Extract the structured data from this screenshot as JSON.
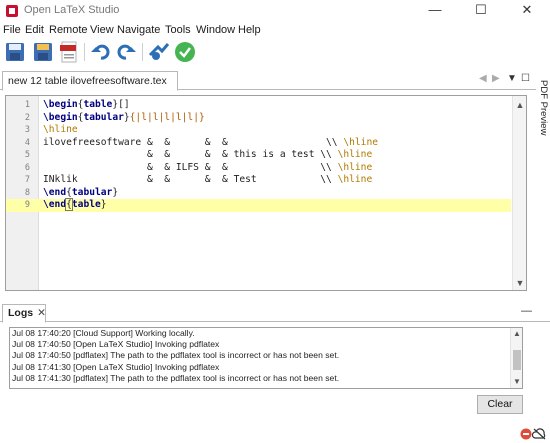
{
  "window": {
    "title": "Open LaTeX Studio",
    "minimize": "—",
    "maximize": "☐",
    "close": "✕"
  },
  "menu": [
    "File",
    "Edit",
    "Remote",
    "View",
    "Navigate",
    "Tools",
    "Window",
    "Help"
  ],
  "toolbar": {
    "icons": [
      "save-icon",
      "save-all-icon",
      "pdf-export-icon",
      "undo-icon",
      "redo-icon",
      "dropbox-icon",
      "compile-check-icon"
    ],
    "colors": {
      "save": "#4472c4",
      "undo": "#2d6fb7",
      "compile": "#46b450"
    }
  },
  "editor": {
    "tab_label": "new 12 table ilovefreesoftware.tex",
    "tab_controls": [
      "◀",
      "▶",
      "▼",
      "☐"
    ],
    "lines": [
      {
        "n": "1",
        "parts": [
          [
            "kw",
            "\\begin"
          ],
          [
            "",
            "{"
          ],
          [
            "kw",
            "table"
          ],
          [
            "",
            "}[]"
          ]
        ]
      },
      {
        "n": "2",
        "parts": [
          [
            "kw",
            "\\begin"
          ],
          [
            "",
            "{"
          ],
          [
            "kw",
            "tabular"
          ],
          [
            "",
            "}"
          ],
          [
            "br",
            "{|l|l|l|l|l|}"
          ]
        ]
      },
      {
        "n": "3",
        "parts": [
          [
            "hl",
            "\\hline"
          ]
        ]
      },
      {
        "n": "4",
        "parts": [
          [
            "",
            "ilovefreesoftware &  &      &  &                 \\\\ "
          ],
          [
            "hl",
            "\\hline"
          ]
        ]
      },
      {
        "n": "5",
        "parts": [
          [
            "",
            "                  &  &      &  & this is a test \\\\ "
          ],
          [
            "hl",
            "\\hline"
          ]
        ]
      },
      {
        "n": "6",
        "parts": [
          [
            "",
            "                  &  & ILFS &  &                \\\\ "
          ],
          [
            "hl",
            "\\hline"
          ]
        ]
      },
      {
        "n": "7",
        "parts": [
          [
            "",
            "INklik            &  &      &  & Test           \\\\ "
          ],
          [
            "hl",
            "\\hline"
          ]
        ]
      },
      {
        "n": "8",
        "parts": [
          [
            "kw",
            "\\end"
          ],
          [
            "",
            "{"
          ],
          [
            "kw",
            "tabular"
          ],
          [
            "",
            "}"
          ]
        ]
      },
      {
        "n": "9",
        "parts": [
          [
            "kw",
            "\\end"
          ],
          [
            "cur",
            "{"
          ],
          [
            "kw",
            "table"
          ],
          [
            "",
            "}"
          ]
        ]
      }
    ],
    "current_line": 9,
    "scroll_up": "▲",
    "scroll_down": "▼"
  },
  "side_panel": {
    "label": "PDF Preview"
  },
  "logs": {
    "tab_label": "Logs",
    "tab_close": "✕",
    "minimize": "—",
    "lines": [
      "Jul 08 17:40:20 [Cloud Support] Working locally.",
      "Jul 08 17:40:50 [Open LaTeX Studio] Invoking pdflatex",
      "Jul 08 17:40:50 [pdflatex] The path to the pdflatex tool is incorrect or has not been set.",
      "Jul 08 17:41:30 [Open LaTeX Studio] Invoking pdflatex",
      "Jul 08 17:41:30 [pdflatex] The path to the pdflatex tool is incorrect or has not been set."
    ],
    "clear_label": "Clear"
  },
  "status": {
    "icons": [
      "stop-icon",
      "cloud-offline-icon"
    ]
  }
}
